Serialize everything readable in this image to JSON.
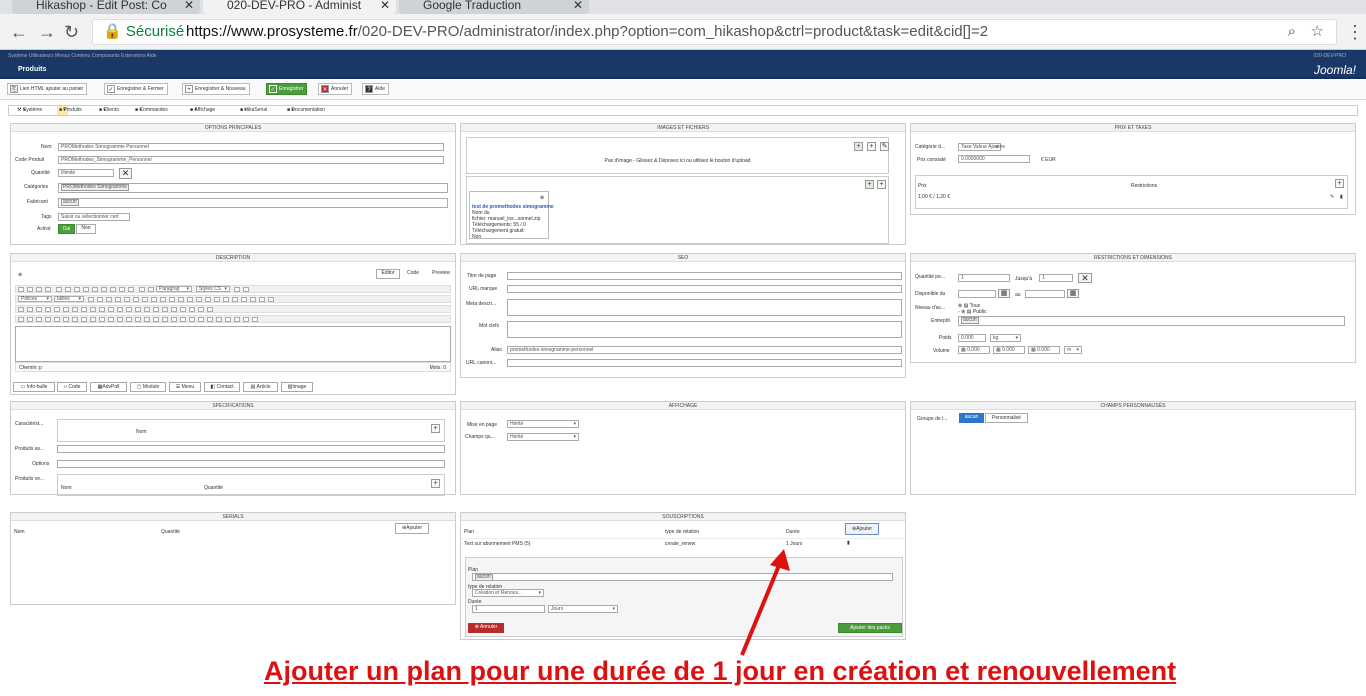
{
  "browser": {
    "tabs": [
      {
        "label": "Hikashop - Edit Post: Co"
      },
      {
        "label": "020-DEV-PRO - Administ"
      },
      {
        "label": "Google Traduction"
      }
    ],
    "secure_label": "Sécurisé",
    "url_host": "https://www.prosysteme.fr",
    "url_path": "/020-DEV-PRO/administrator/index.php?option=com_hikashop&ctrl=product&task=edit&cid[]=2"
  },
  "joomla": {
    "top_menu": "Système   Utilisateurs   Menus   Contenu   Composants   Extensions   Aide",
    "top_right": "020-DEV-PRO",
    "page_title": "Produits",
    "logo": "Joomla!"
  },
  "toolbar": {
    "html_link": "Lien HTML ajouter au panier",
    "save_close": "Enregistrer & Fermer",
    "save_new": "Enregistrer & Nouveau",
    "save": "Enregistrer",
    "cancel": "Annuler",
    "help": "Aide"
  },
  "hikamenu": {
    "system": "Système",
    "products": "Produits",
    "customers": "Clients",
    "orders": "Commandes",
    "display": "Affichage",
    "hikaserial": "HikaSerial",
    "docs": "Documentation"
  },
  "main_options": {
    "title": "OPTIONS PRINCIPALES",
    "name_label": "Nom",
    "name_value": "PROMethodes Simogramme Personnel",
    "code_label": "Code Produit",
    "code_value": "PROMethodes_Simogramme_Personnel",
    "qty_label": "Quantité",
    "qty_value": "Illimité",
    "cat_label": "Catégories",
    "cat_value": "PROMethodes Simogramme",
    "maker_label": "Fabricant",
    "maker_value": "aucun",
    "tags_label": "Tags",
    "tags_placeholder": "Saisir ou sélectionner cert",
    "active_label": "Activé",
    "yes": "Oui",
    "no": "Non"
  },
  "images": {
    "title": "IMAGES ET FICHIERS",
    "dropzone": "Pas d'image - Glissez & Déposez ici ou utilisez le bouton d'upload",
    "file_title": "test de promethodes simogramme",
    "file_name_label": "Nom du",
    "file_label": "fichier: manuel_ins...sonnel.zip",
    "downloads": "Téléchargements: 55 / 0",
    "free_download": "Téléchargement gratuit:",
    "free_value": "Non"
  },
  "prices": {
    "title": "PRIX ET TAXES",
    "tax_label": "Catégorie d...",
    "tax_value": "Taxe Valeur Ajoutée",
    "cost_label": "Prix constaté",
    "cost_value": "0.0000000",
    "cost_currency": "€ EUR",
    "price_col": "Prix",
    "restrictions_col": "Restrictions",
    "price_row": "1,00 € / 1,20 €"
  },
  "description": {
    "title": "DESCRIPTION",
    "tab_editor": "Editor",
    "tab_code": "Code",
    "tab_preview": "Preview",
    "paragraph": "Paragrap",
    "styles": "Styles CS",
    "fonts": "Polices",
    "size": "tailles",
    "path": "Chemin: p",
    "words": "Mots: 0",
    "buttons": [
      "Info-bulle",
      "Code",
      "AdvPoll",
      "Module",
      "Menu",
      "Contact",
      "Article",
      "Image"
    ]
  },
  "seo": {
    "title": "SEO",
    "page_title_label": "Titre de page",
    "url_brand_label": "URL marque",
    "meta_label": "Meta descri...",
    "keywords_label": "Mot clefs",
    "alias_label": "Alias",
    "alias_value": "promethodes-simogramme-personnel",
    "canonical_label": "URL canoni..."
  },
  "restrictions": {
    "title": "RESTRICTIONS ET DIMENSIONS",
    "qty_label": "Quantité pe...",
    "qty_min": "1",
    "until_label": "Jusqu'à",
    "qty_max": "1",
    "avail_label": "Disponible du",
    "to_label": "au",
    "access_label": "Niveau d'ac...",
    "access_all": "Tous",
    "access_public": "Public",
    "warehouse_label": "Entrepôt",
    "warehouse_value": "aucun",
    "weight_label": "Poids",
    "weight_value": "0.000",
    "weight_unit": "kg",
    "volume_label": "Volume",
    "vol_1": "0.000",
    "vol_2": "0.000",
    "vol_3": "0.000",
    "vol_unit": "m"
  },
  "specs": {
    "title": "SPÉCIFICATIONS",
    "features_label": "Caractérist...",
    "name_col": "Nom",
    "related_label": "Produits as...",
    "options_label": "Options",
    "upsell_label": "Produits ve...",
    "qty_col": "Quantité"
  },
  "display": {
    "title": "AFFICHAGE",
    "layout_label": "Mise en page",
    "layout_value": "Hérité",
    "fields_label": "Champs qu...",
    "fields_value": "Hérité"
  },
  "custom_fields": {
    "title": "CHAMPS PERSONNALISÉS",
    "group_label": "Groupe de l...",
    "none": "aucun",
    "custom": "Personnalisé"
  },
  "serials": {
    "title": "SERIALS",
    "name_col": "Nom",
    "qty_col": "Quantité",
    "add": "Ajouter"
  },
  "subscriptions": {
    "title": "SOUSCRIPTIONS",
    "plan_col": "Plan",
    "relation_col": "type de relation",
    "duration_col": "Durée",
    "add": "Ajouter",
    "row_plan": "Test sur abonnement PMS (5)",
    "row_relation": "create_renew",
    "row_duration": "1 Jours",
    "form_plan_label": "Plan",
    "form_plan_value": "aucun",
    "form_relation_label": "type de relation",
    "form_relation_value": "Création et Renouv...",
    "form_duration_label": "Durée",
    "form_duration_value": "1",
    "form_unit": "Jours",
    "cancel": "Annuler",
    "add_packs": "Ajouter des packs"
  },
  "annotation": "Ajouter un plan pour une durée de 1 jour en création et renouvellement",
  "colors": {
    "annotation": "#dd1111",
    "joomla_bar": "#1a3867",
    "green": "#4a9d3a",
    "red": "#b62b2b",
    "blue": "#2a78c6"
  }
}
